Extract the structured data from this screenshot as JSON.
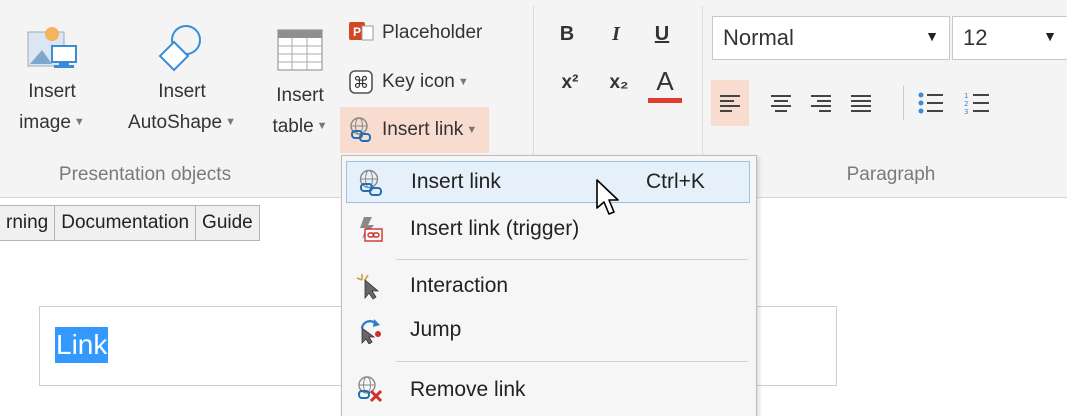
{
  "ribbon": {
    "insert_image": {
      "line1": "Insert",
      "line2": "image",
      "icon": "image-icon"
    },
    "insert_autoshape": {
      "line1": "Insert",
      "line2": "AutoShape",
      "icon": "autoshape-icon"
    },
    "insert_table": {
      "line1": "Insert",
      "line2": "table",
      "icon": "table-icon"
    },
    "placeholder": {
      "label": "Placeholder",
      "icon": "placeholder-icon"
    },
    "key_icon": {
      "label": "Key icon",
      "icon": "command-key-icon"
    },
    "insert_link": {
      "label": "Insert link",
      "icon": "link-icon"
    },
    "presentation_objects_label": "Presentation objects",
    "format": {
      "bold": "B",
      "italic": "I",
      "underline": "U",
      "superscript": "x²",
      "subscript": "x₂",
      "font_color": "A",
      "font_color_value": "#e03c31"
    },
    "style_value": "Normal",
    "size_value": "12",
    "paragraph_label": "Paragraph"
  },
  "tabs": [
    "rning",
    "Documentation",
    "Guide"
  ],
  "editor": {
    "selected_text": "Link"
  },
  "menu": {
    "items": [
      {
        "label": "Insert link",
        "shortcut": "Ctrl+K",
        "icon": "link-icon"
      },
      {
        "label": "Insert link (trigger)",
        "icon": "link-trigger-icon"
      },
      {
        "label": "Interaction",
        "icon": "interaction-icon"
      },
      {
        "label": "Jump",
        "icon": "jump-icon"
      },
      {
        "label": "Remove link",
        "icon": "remove-link-icon"
      }
    ]
  },
  "colors": {
    "accent_active": "#f8dccf",
    "selection": "#3399ff",
    "menu_hover": "#e6f0fa"
  }
}
